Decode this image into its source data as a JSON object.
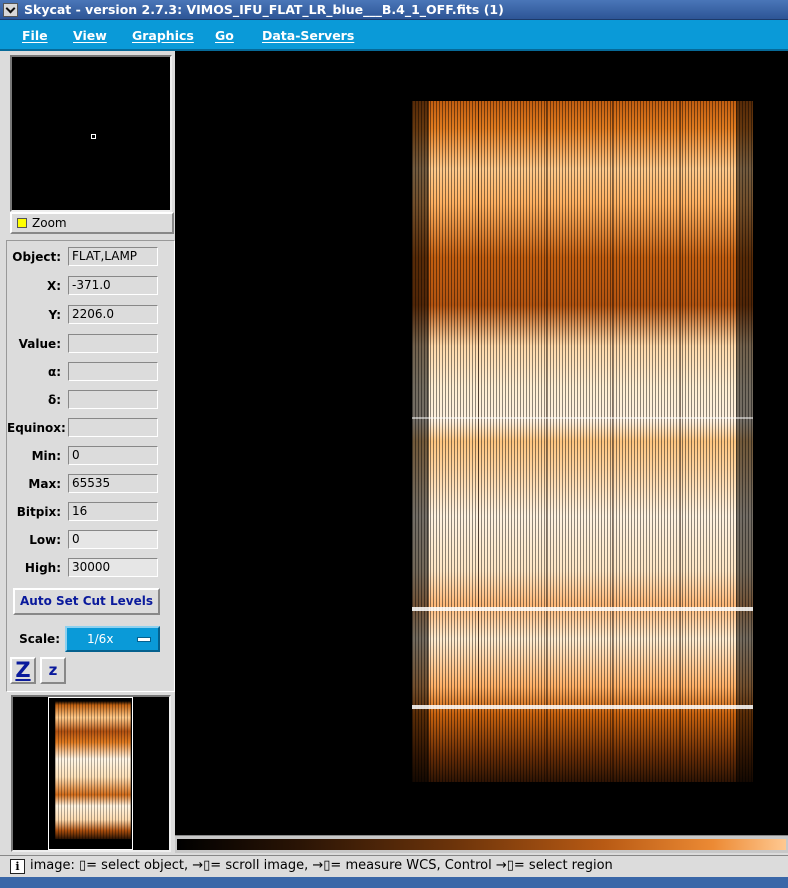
{
  "window": {
    "title": "Skycat - version 2.7.3: VIMOS_IFU_FLAT_LR_blue___B.4_1_OFF.fits (1)"
  },
  "menu": [
    "File",
    "View",
    "Graphics",
    "Go",
    "Data-Servers"
  ],
  "panel": {
    "zoom_label": "Zoom",
    "fields": [
      {
        "label": "Object:",
        "value": "FLAT,LAMP"
      },
      {
        "label": "X:",
        "value": "-371.0"
      },
      {
        "label": "Y:",
        "value": "2206.0"
      },
      {
        "label": "Value:",
        "value": ""
      },
      {
        "label": "α:",
        "value": ""
      },
      {
        "label": "δ:",
        "value": ""
      },
      {
        "label": "Equinox:",
        "value": ""
      },
      {
        "label": "Min:",
        "value": "0"
      },
      {
        "label": "Max:",
        "value": "65535"
      },
      {
        "label": "Bitpix:",
        "value": "16"
      },
      {
        "label": "Low:",
        "value": "0"
      },
      {
        "label": "High:",
        "value": "30000"
      }
    ],
    "cut_button": "Auto Set Cut Levels",
    "scale_label": "Scale:",
    "scale_value": "1/6x",
    "zoom_in": "Z",
    "zoom_out": "z"
  },
  "status": {
    "icon": "i",
    "text": "image: ▯= select object, →▯= scroll image, →▯= measure WCS, Control →▯= select region"
  },
  "colors": {
    "menubar": "#0a9ad8",
    "titlebar": "#2d5596",
    "image_accent": "#e07a20"
  }
}
